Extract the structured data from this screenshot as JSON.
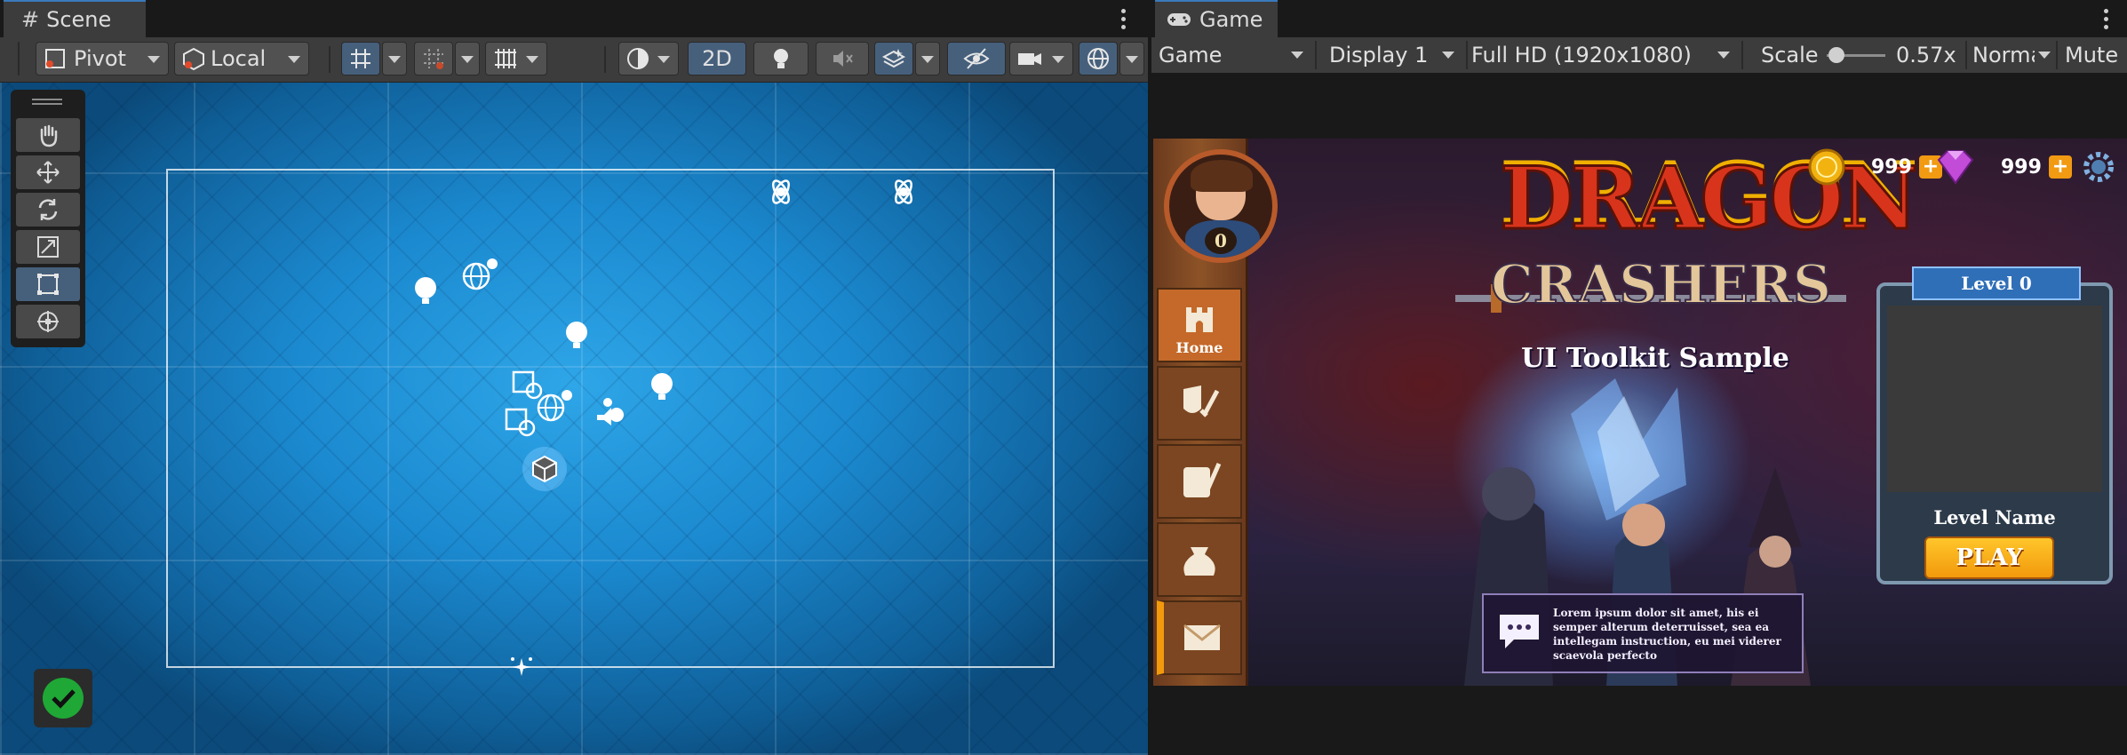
{
  "scene": {
    "tab_title": "Scene",
    "toolbar": {
      "pivot_label": "Pivot",
      "local_label": "Local",
      "mode_2d_label": "2D"
    }
  },
  "game": {
    "tab_title": "Game",
    "toolbar": {
      "view_label": "Game",
      "display_label": "Display 1",
      "resolution_label": "Full HD (1920x1080)",
      "scale_label": "Scale",
      "scale_value": "0.57x",
      "scale_fraction": 0.05,
      "normal_label": "Norma",
      "mute_label": "Mute"
    },
    "content": {
      "title_line1": "DRAGON",
      "title_line2": "CRASHERS",
      "subtitle": "UI Toolkit Sample",
      "player_level": "0",
      "gold_amount": "999",
      "gem_amount": "999",
      "nav_home_label": "Home",
      "level_ribbon": "Level 0",
      "level_name": "Level Name",
      "play_label": "PLAY",
      "chat_message": "Lorem ipsum dolor sit amet, his ei semper alterum deterruisset, sea ea intellegam instruction, eu mei viderer scaevola perfecto"
    }
  },
  "colors": {
    "accent": "#3a79bb",
    "active_tool": "#46607c",
    "gold": "#f29a0c",
    "status_ok": "#1fa836"
  }
}
